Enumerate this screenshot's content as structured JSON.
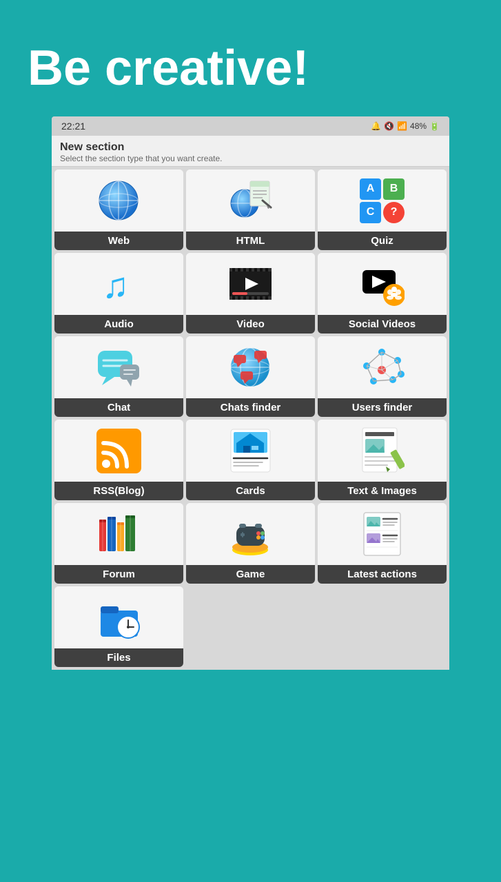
{
  "hero": {
    "text": "Be creative!"
  },
  "statusBar": {
    "time": "22:21",
    "battery": "48%"
  },
  "sectionHeader": {
    "title": "New section",
    "subtitle": "Select the section type that you want create."
  },
  "grid": {
    "items": [
      {
        "id": "web",
        "label": "Web",
        "icon": "web"
      },
      {
        "id": "html",
        "label": "HTML",
        "icon": "html"
      },
      {
        "id": "quiz",
        "label": "Quiz",
        "icon": "quiz"
      },
      {
        "id": "audio",
        "label": "Audio",
        "icon": "audio"
      },
      {
        "id": "video",
        "label": "Video",
        "icon": "video"
      },
      {
        "id": "social-videos",
        "label": "Social Videos",
        "icon": "social-videos"
      },
      {
        "id": "chat",
        "label": "Chat",
        "icon": "chat"
      },
      {
        "id": "chats-finder",
        "label": "Chats finder",
        "icon": "chats-finder"
      },
      {
        "id": "users-finder",
        "label": "Users finder",
        "icon": "users-finder"
      },
      {
        "id": "rss",
        "label": "RSS(Blog)",
        "icon": "rss"
      },
      {
        "id": "cards",
        "label": "Cards",
        "icon": "cards"
      },
      {
        "id": "text-images",
        "label": "Text & Images",
        "icon": "text-images"
      },
      {
        "id": "forum",
        "label": "Forum",
        "icon": "forum"
      },
      {
        "id": "game",
        "label": "Game",
        "icon": "game"
      },
      {
        "id": "latest-actions",
        "label": "Latest actions",
        "icon": "latest-actions"
      },
      {
        "id": "files",
        "label": "Files",
        "icon": "files"
      }
    ]
  }
}
